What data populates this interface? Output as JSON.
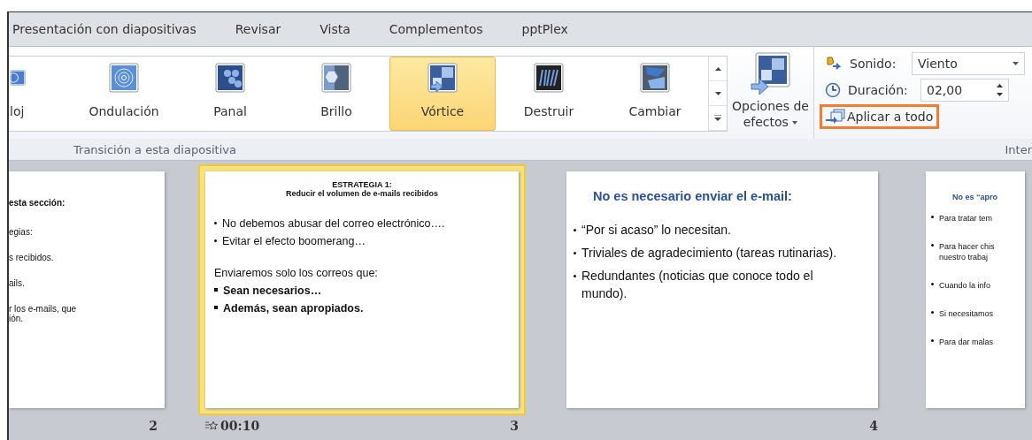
{
  "menu_tabs": [
    "Presentación con diapositivas",
    "Revisar",
    "Vista",
    "Complementos",
    "pptPlex"
  ],
  "gallery": {
    "items": [
      {
        "label": "loj",
        "selected": false
      },
      {
        "label": "Ondulación",
        "selected": false
      },
      {
        "label": "Panal",
        "selected": false
      },
      {
        "label": "Brillo",
        "selected": false
      },
      {
        "label": "Vórtice",
        "selected": true
      },
      {
        "label": "Destruir",
        "selected": false
      },
      {
        "label": "Cambiar",
        "selected": false
      }
    ]
  },
  "effect_options": {
    "label": "Opciones de efectos"
  },
  "group_label": "Transición a esta diapositiva",
  "timing": {
    "sound_label": "Sonido:",
    "sound_value": "Viento",
    "duration_label": "Duración:",
    "duration_value": "02,00",
    "apply_all": {
      "label": "Aplicar a todo",
      "highlighted": true
    },
    "group_label": "Inter"
  },
  "slides": [
    {
      "number": "2",
      "selected": false,
      "lines": [
        {
          "kind": "heading",
          "text": "esta sección:"
        },
        {
          "kind": "text",
          "text": "egias:"
        },
        {
          "kind": "text",
          "text": "s recibidos."
        },
        {
          "kind": "text",
          "text": "ails."
        },
        {
          "kind": "text",
          "text": "r  los e-mails, que"
        },
        {
          "kind": "cont",
          "text": "ión."
        }
      ]
    },
    {
      "number": "3",
      "selected": true,
      "timing": "00:10",
      "lines": [
        {
          "kind": "title",
          "text": "ESTRATEGIA 1:"
        },
        {
          "kind": "subtitle",
          "text": "Reducir el volumen de e-mails recibidos"
        },
        {
          "kind": "bullet",
          "text": "No debemos abusar del correo electrónico…."
        },
        {
          "kind": "bullet",
          "text": "Evitar el efecto boomerang…"
        },
        {
          "kind": "para",
          "text": "Enviaremos solo los correos que:"
        },
        {
          "kind": "strong",
          "text": "Sean necesarios…"
        },
        {
          "kind": "strong",
          "text": "Además, sean apropiados."
        }
      ]
    },
    {
      "number": "4",
      "selected": false,
      "lines": [
        {
          "kind": "blue-title",
          "text": "No es necesario enviar el e-mail:"
        },
        {
          "kind": "bullet",
          "text": "“Por si acaso” lo necesitan."
        },
        {
          "kind": "bullet",
          "text": "Triviales de agradecimiento (tareas rutinarias)."
        },
        {
          "kind": "bullet",
          "text": "Redundantes (noticias que conoce todo el mundo)."
        }
      ]
    },
    {
      "selected": false,
      "lines": [
        {
          "kind": "small-title",
          "text": "No es “apro"
        },
        {
          "kind": "small-bullet",
          "text": "Para tratar tem"
        },
        {
          "kind": "small-bullet",
          "text": "Para hacer chis"
        },
        {
          "kind": "small-cont",
          "text": "nuestro trabaj"
        },
        {
          "kind": "small-bullet",
          "text": "Cuando la info"
        },
        {
          "kind": "small-bullet",
          "text": "Si necesitamos"
        },
        {
          "kind": "small-bullet",
          "text": "Para dar malas"
        }
      ]
    }
  ]
}
